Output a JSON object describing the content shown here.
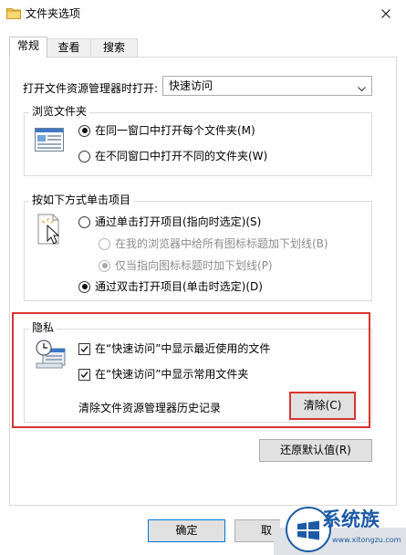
{
  "window": {
    "title": "文件夹选项",
    "accent_color": "#d8352f"
  },
  "tabs": [
    {
      "label": "常规",
      "active": true
    },
    {
      "label": "查看",
      "active": false
    },
    {
      "label": "搜索",
      "active": false
    }
  ],
  "open_in": {
    "label": "打开文件资源管理器时打开:",
    "value": "快速访问"
  },
  "browse": {
    "legend": "浏览文件夹",
    "icon": "folder-window-icon",
    "options": [
      {
        "label": "在同一窗口中打开每个文件夹(M)",
        "selected": true
      },
      {
        "label": "在不同窗口中打开不同的文件夹(W)",
        "selected": false
      }
    ]
  },
  "click": {
    "legend": "按如下方式单击项目",
    "icon": "cursor-click-icon",
    "single": {
      "label": "通过单击打开项目(指向时选定)(S)",
      "selected": false
    },
    "sub_options": [
      {
        "label": "在我的浏览器中给所有图标标题加下划线(B)",
        "selected": false
      },
      {
        "label": "仅当指向图标标题时加下划线(P)",
        "selected": true
      }
    ],
    "double": {
      "label": "通过双击打开项目(单击时选定)(D)",
      "selected": true
    }
  },
  "privacy": {
    "legend": "隐私",
    "icon": "privacy-clock-icon",
    "checks": [
      {
        "label": "在“快速访问”中显示最近使用的文件",
        "checked": true
      },
      {
        "label": "在“快速访问”中显示常用文件夹",
        "checked": true
      }
    ],
    "clear_label": "清除文件资源管理器历史记录",
    "clear_button": "清除(C)"
  },
  "restore_button": "还原默认值(R)",
  "footer": {
    "ok": "确定",
    "cancel_partial": "取"
  },
  "watermark": {
    "name": "系统族",
    "url": "www.xitongzu.com"
  }
}
